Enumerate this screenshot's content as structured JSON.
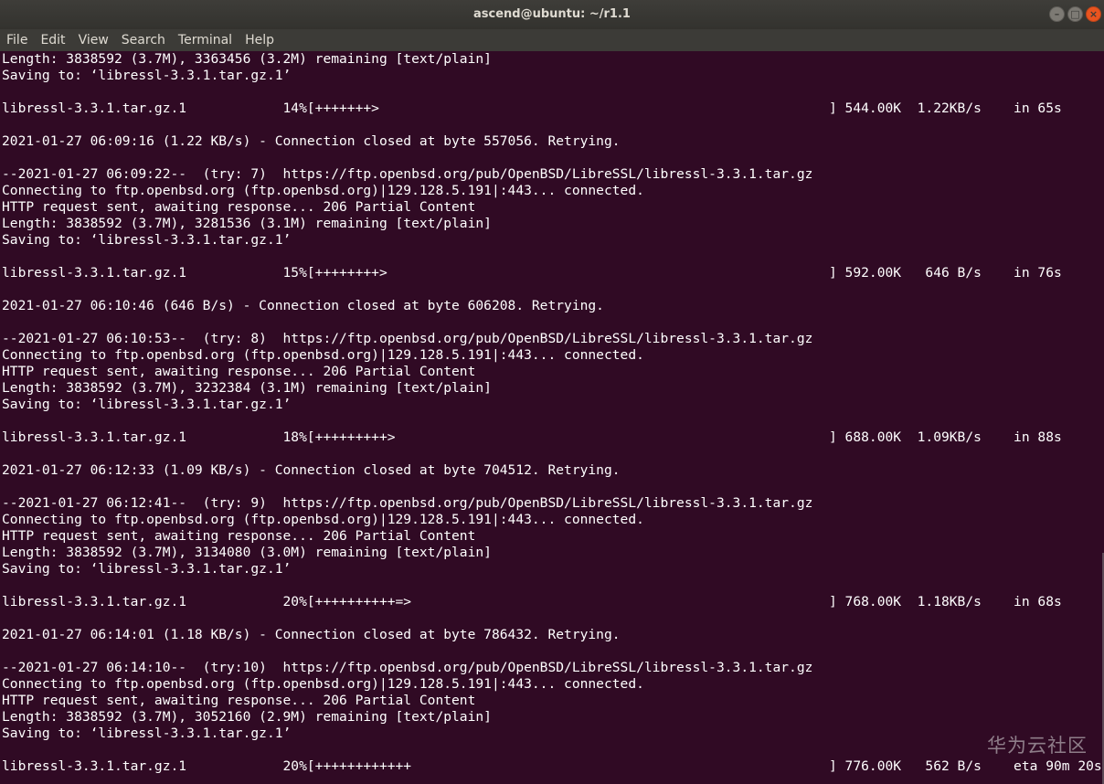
{
  "window": {
    "title": "ascend@ubuntu: ~/r1.1",
    "controls": {
      "minimize_glyph": "–",
      "maximize_glyph": "□",
      "close_glyph": "×"
    },
    "colors": {
      "terminal_bg": "#300a24",
      "text": "#ffffff",
      "titlebar": "#3c3b37",
      "close_button": "#e9541f"
    }
  },
  "menubar": {
    "items": [
      "File",
      "Edit",
      "View",
      "Search",
      "Terminal",
      "Help"
    ]
  },
  "terminal": {
    "lines": [
      "Length: 3838592 (3.7M), 3363456 (3.2M) remaining [text/plain]",
      "Saving to: ‘libressl-3.3.1.tar.gz.1’",
      "",
      "libressl-3.3.1.tar.gz.1            14%[+++++++>                                                        ] 544.00K  1.22KB/s    in 65s",
      "",
      "2021-01-27 06:09:16 (1.22 KB/s) - Connection closed at byte 557056. Retrying.",
      "",
      "--2021-01-27 06:09:22--  (try: 7)  https://ftp.openbsd.org/pub/OpenBSD/LibreSSL/libressl-3.3.1.tar.gz",
      "Connecting to ftp.openbsd.org (ftp.openbsd.org)|129.128.5.191|:443... connected.",
      "HTTP request sent, awaiting response... 206 Partial Content",
      "Length: 3838592 (3.7M), 3281536 (3.1M) remaining [text/plain]",
      "Saving to: ‘libressl-3.3.1.tar.gz.1’",
      "",
      "libressl-3.3.1.tar.gz.1            15%[++++++++>                                                       ] 592.00K   646 B/s    in 76s",
      "",
      "2021-01-27 06:10:46 (646 B/s) - Connection closed at byte 606208. Retrying.",
      "",
      "--2021-01-27 06:10:53--  (try: 8)  https://ftp.openbsd.org/pub/OpenBSD/LibreSSL/libressl-3.3.1.tar.gz",
      "Connecting to ftp.openbsd.org (ftp.openbsd.org)|129.128.5.191|:443... connected.",
      "HTTP request sent, awaiting response... 206 Partial Content",
      "Length: 3838592 (3.7M), 3232384 (3.1M) remaining [text/plain]",
      "Saving to: ‘libressl-3.3.1.tar.gz.1’",
      "",
      "libressl-3.3.1.tar.gz.1            18%[+++++++++>                                                      ] 688.00K  1.09KB/s    in 88s",
      "",
      "2021-01-27 06:12:33 (1.09 KB/s) - Connection closed at byte 704512. Retrying.",
      "",
      "--2021-01-27 06:12:41--  (try: 9)  https://ftp.openbsd.org/pub/OpenBSD/LibreSSL/libressl-3.3.1.tar.gz",
      "Connecting to ftp.openbsd.org (ftp.openbsd.org)|129.128.5.191|:443... connected.",
      "HTTP request sent, awaiting response... 206 Partial Content",
      "Length: 3838592 (3.7M), 3134080 (3.0M) remaining [text/plain]",
      "Saving to: ‘libressl-3.3.1.tar.gz.1’",
      "",
      "libressl-3.3.1.tar.gz.1            20%[++++++++++=>                                                    ] 768.00K  1.18KB/s    in 68s",
      "",
      "2021-01-27 06:14:01 (1.18 KB/s) - Connection closed at byte 786432. Retrying.",
      "",
      "--2021-01-27 06:14:10--  (try:10)  https://ftp.openbsd.org/pub/OpenBSD/LibreSSL/libressl-3.3.1.tar.gz",
      "Connecting to ftp.openbsd.org (ftp.openbsd.org)|129.128.5.191|:443... connected.",
      "HTTP request sent, awaiting response... 206 Partial Content",
      "Length: 3838592 (3.7M), 3052160 (2.9M) remaining [text/plain]",
      "Saving to: ‘libressl-3.3.1.tar.gz.1’",
      "",
      "libressl-3.3.1.tar.gz.1            20%[++++++++++++                                                    ] 776.00K   562 B/s    eta 90m 20s"
    ]
  },
  "watermark": {
    "text": "华为云社区"
  }
}
